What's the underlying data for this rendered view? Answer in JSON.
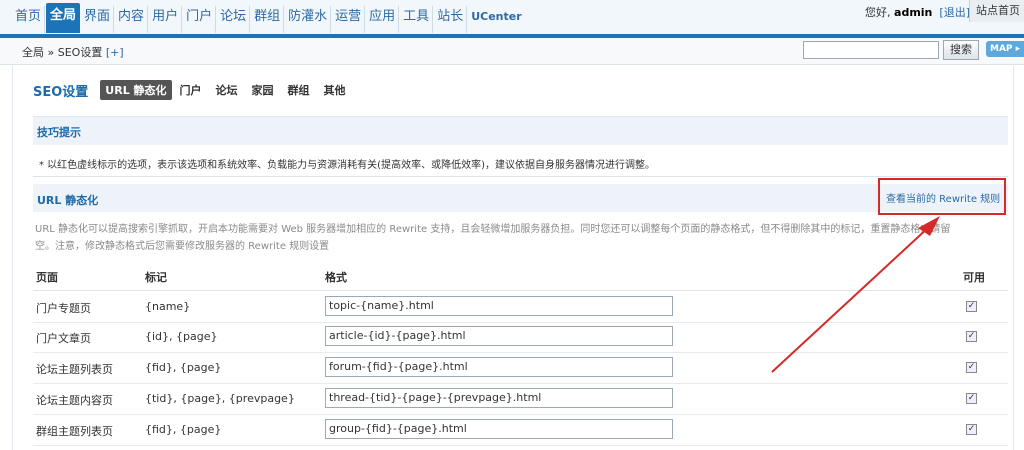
{
  "topnav": {
    "items": [
      "首页",
      "全局",
      "界面",
      "内容",
      "用户",
      "门户",
      "论坛",
      "群组",
      "防灌水",
      "运营",
      "应用",
      "工具",
      "站长",
      "UCenter"
    ],
    "active": "全局"
  },
  "userbar": {
    "greeting": "您好,",
    "username": "admin",
    "logout": "[退出]",
    "site_home": "站点首页"
  },
  "subbar": {
    "breadcrumb": "全局 » SEO设置",
    "add": "[+]",
    "search_button": "搜索",
    "map_button": "MAP ▸"
  },
  "seo": {
    "title": "SEO设置",
    "tabs": [
      "URL 静态化",
      "门户",
      "论坛",
      "家园",
      "群组",
      "其他"
    ]
  },
  "tips": {
    "title": "技巧提示",
    "line": "*  以红色虚线标示的选项，表示该选项和系统效率、负载能力与资源消耗有关(提高效率、或降低效率)，建议依据自身服务器情况进行调整。"
  },
  "urlstatic": {
    "title": "URL 静态化",
    "rewrite_link": "查看当前的 Rewrite 规则",
    "desc": "URL 静态化可以提高搜索引擎抓取，开启本功能需要对 Web 服务器增加相应的 Rewrite 支持，且会轻微增加服务器负担。同时您还可以调整每个页面的静态格式，但不得删除其中的标记，重置静态格式请留空。注意，修改静态格式后您需要修改服务器的 Rewrite 规则设置"
  },
  "table": {
    "headers": {
      "page": "页面",
      "mark": "标记",
      "format": "格式",
      "enabled": "可用"
    },
    "rows": [
      {
        "page": "门户专题页",
        "mark": "{name}",
        "format": "topic-{name}.html",
        "enabled": "✓"
      },
      {
        "page": "门户文章页",
        "mark": "{id}, {page}",
        "format": "article-{id}-{page}.html",
        "enabled": "✓"
      },
      {
        "page": "论坛主题列表页",
        "mark": "{fid}, {page}",
        "format": "forum-{fid}-{page}.html",
        "enabled": "✓"
      },
      {
        "page": "论坛主题内容页",
        "mark": "{tid}, {page}, {prevpage}",
        "format": "thread-{tid}-{page}-{prevpage}.html",
        "enabled": "✓"
      },
      {
        "page": "群组主题列表页",
        "mark": "{fid}, {page}",
        "format": "group-{fid}-{page}.html",
        "enabled": "✓"
      }
    ]
  },
  "colors": {
    "accent": "#1b74b7",
    "annotation": "#d62a2a"
  }
}
